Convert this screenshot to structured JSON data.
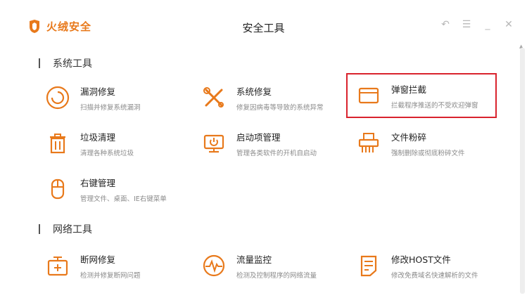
{
  "app": {
    "brand": "火绒安全",
    "window_title": "安全工具",
    "accent_color": "#e8791b",
    "highlight_color": "#d9232d"
  },
  "window_controls": [
    {
      "name": "back-icon",
      "glyph": "↶"
    },
    {
      "name": "menu-icon",
      "glyph": "☰"
    },
    {
      "name": "minimize-icon",
      "glyph": "_"
    },
    {
      "name": "close-icon",
      "glyph": "✕"
    }
  ],
  "sections": {
    "system": {
      "title": "系统工具",
      "tools": [
        {
          "name": "漏洞修复",
          "desc": "扫描并修复系统漏洞",
          "icon": "vulnerability-repair-icon"
        },
        {
          "name": "系统修复",
          "desc": "修复因病毒等导致的系统异常",
          "icon": "system-repair-icon"
        },
        {
          "name": "弹窗拦截",
          "desc": "拦截程序推送的不受欢迎弹窗",
          "icon": "popup-block-icon",
          "highlighted": true
        },
        {
          "name": "垃圾清理",
          "desc": "清理各种系统垃圾",
          "icon": "trash-clean-icon"
        },
        {
          "name": "启动项管理",
          "desc": "管理各类软件的开机自启动",
          "icon": "startup-manager-icon"
        },
        {
          "name": "文件粉碎",
          "desc": "强制删除或彻底粉碎文件",
          "icon": "file-shredder-icon"
        },
        {
          "name": "右键管理",
          "desc": "管理文件、桌面、IE右键菜单",
          "icon": "right-click-manager-icon"
        }
      ]
    },
    "network": {
      "title": "网络工具",
      "tools": [
        {
          "name": "断网修复",
          "desc": "检测并修复断网问题",
          "icon": "network-repair-icon"
        },
        {
          "name": "流量监控",
          "desc": "检测及控制程序的网络流量",
          "icon": "traffic-monitor-icon"
        },
        {
          "name": "修改HOST文件",
          "desc": "修改免费域名快速解析的文件",
          "icon": "host-file-icon"
        }
      ]
    }
  }
}
